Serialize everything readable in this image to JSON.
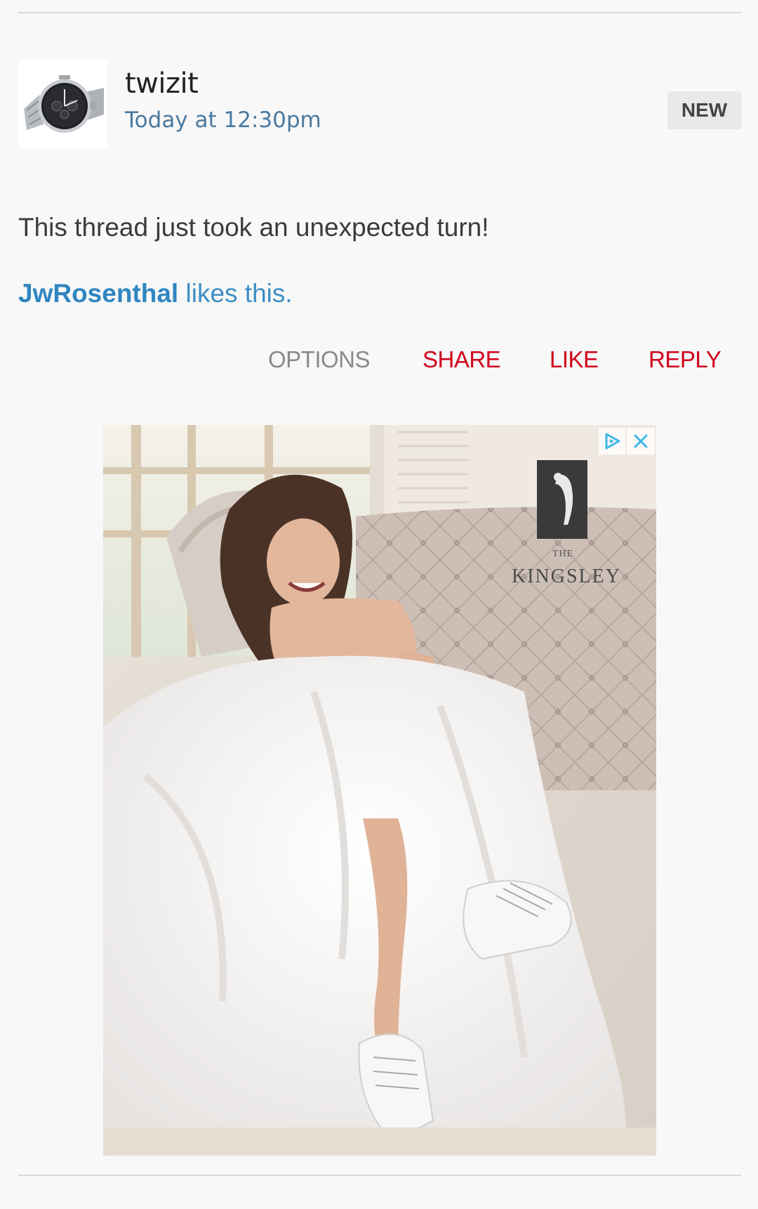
{
  "post": {
    "username": "twizit",
    "timestamp": "Today at 12:30pm",
    "badge": "NEW",
    "avatar_icon": "watch-icon",
    "text": "This thread just took an unexpected turn!",
    "likes": {
      "liker": "JwRosenthal",
      "suffix": " likes this."
    }
  },
  "actions": {
    "options": "OPTIONS",
    "share": "SHARE",
    "like": "LIKE",
    "reply": "REPLY"
  },
  "ad": {
    "brand_prefix": "THE",
    "brand_name": "KINGSLEY",
    "choices_icon": "adchoices-icon",
    "close_icon": "close-icon"
  },
  "colors": {
    "link_blue": "#2f86c0",
    "timestamp_blue": "#4a7aa1",
    "action_red": "#d0021b",
    "options_gray": "#8a8a8a",
    "badge_bg": "#e9e9e9"
  }
}
